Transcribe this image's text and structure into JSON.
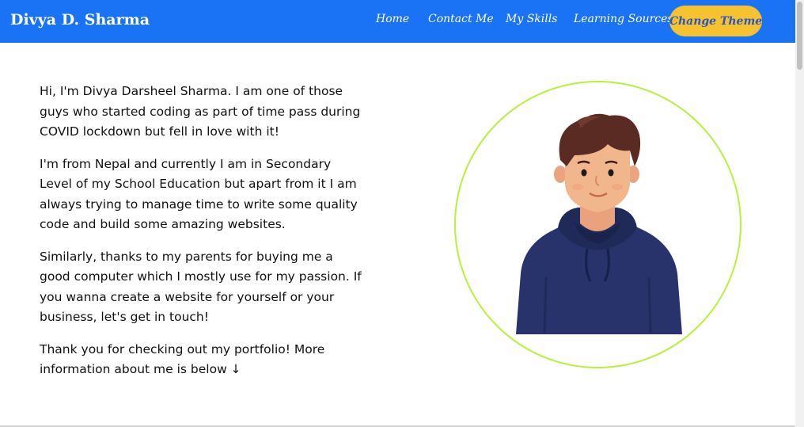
{
  "navbar": {
    "brand": "Divya D. Sharma",
    "links": [
      "Home",
      "Contact Me",
      "My Skills",
      "Learning Sources"
    ],
    "theme_button": "Change Theme"
  },
  "intro": {
    "paragraphs": [
      "Hi, I'm Divya Darsheel Sharma. I am one of those guys who started coding as part of time pass during COVID lockdown but fell in love with it!",
      "I'm from Nepal and currently I am in Secondary Level of my School Education but apart from it I am always trying to manage time to write some quality code and build some amazing websites.",
      "Similarly, thanks to my parents for buying me a good computer which I mostly use for my passion. If you wanna create a website for yourself or your business, let's get in touch!",
      "Thank you for checking out my portfolio! More information about me is below ↓"
    ]
  },
  "colors": {
    "navbar": "#1a73f5",
    "theme_button": "#f7c22f",
    "avatar_ring": "#b6f23a",
    "hoodie": "#27336a",
    "hair": "#5a2b22",
    "skin": "#f2b68d"
  },
  "icons": [
    "avatar-illustration"
  ]
}
